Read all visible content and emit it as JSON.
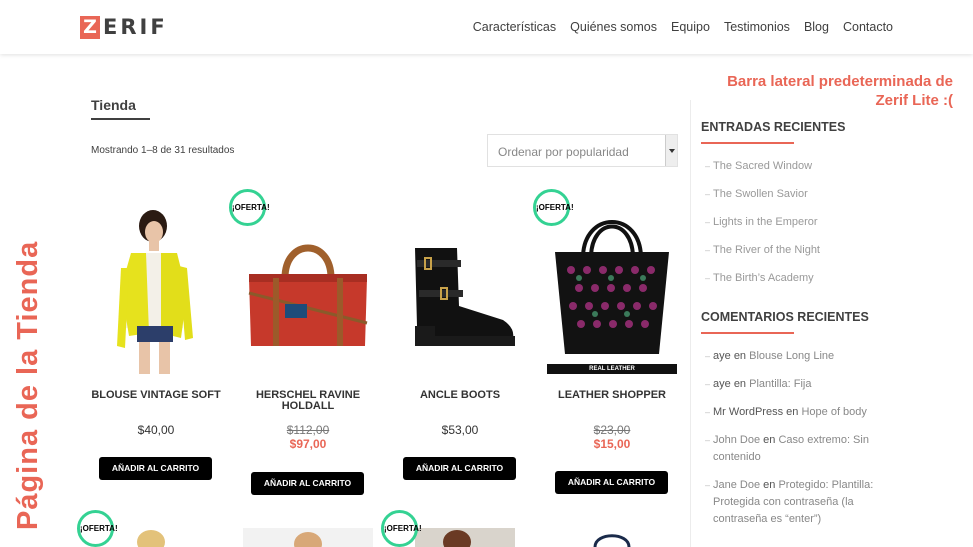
{
  "header": {
    "logo_initial": "Z",
    "logo_rest": "ERIF",
    "nav": [
      "Características",
      "Quiénes somos",
      "Equipo",
      "Testimonios",
      "Blog",
      "Contacto"
    ]
  },
  "main": {
    "title": "Tienda",
    "result_count": "Mostrando 1–8 de 31 resultados",
    "sort": {
      "selected": "Ordenar por popularidad"
    },
    "sale_badge": "¡OFERTA!",
    "products": [
      {
        "name": "BLOUSE VINTAGE SOFT",
        "price": "$40,00",
        "button": "AÑADIR AL CARRITO",
        "image": "blouse-image"
      },
      {
        "name": "HERSCHEL RAVINE HOLDALL",
        "old_price": "$112,00",
        "price": "$97,00",
        "button": "AÑADIR AL CARRITO",
        "image": "holdall-bag-image"
      },
      {
        "name": "ANCLE BOOTS",
        "price": "$53,00",
        "button": "AÑADIR AL CARRITO",
        "image": "ankle-boots-image"
      },
      {
        "name": "LEATHER SHOPPER",
        "old_price": "$23,00",
        "price": "$15,00",
        "button": "AÑADIR AL CARRITO",
        "image": "leather-shopper-image",
        "image_caption": "REAL LEATHER"
      }
    ]
  },
  "sidebar": {
    "note": "Barra lateral predeterminada de Zerif Lite :(",
    "recent_posts_title": "ENTRADAS RECIENTES",
    "recent_posts": [
      "The Sacred Window",
      "The Swollen Savior",
      "Lights in the Emperor",
      "The River of the Night",
      "The Birth’s Academy"
    ],
    "recent_comments_title": "COMENTARIOS RECIENTES",
    "recent_comments": [
      {
        "author": "aye",
        "on": "en",
        "post": "Blouse Long Line"
      },
      {
        "author": "aye",
        "on": "en",
        "post": "Plantilla: Fija"
      },
      {
        "author": "Mr WordPress",
        "on": "en",
        "post": "Hope of body"
      },
      {
        "author": "John Doe",
        "on": "en",
        "post": "Caso extremo: Sin contenido"
      },
      {
        "author": "Jane Doe",
        "on": "en",
        "post": "Protegido: Plantilla: Protegida con contraseña (la contraseña es “enter”)"
      }
    ]
  },
  "overlay_label": "Página de la Tienda",
  "colors": {
    "accent": "#e96656",
    "sale_ring": "#34d293",
    "button": "#000000"
  }
}
